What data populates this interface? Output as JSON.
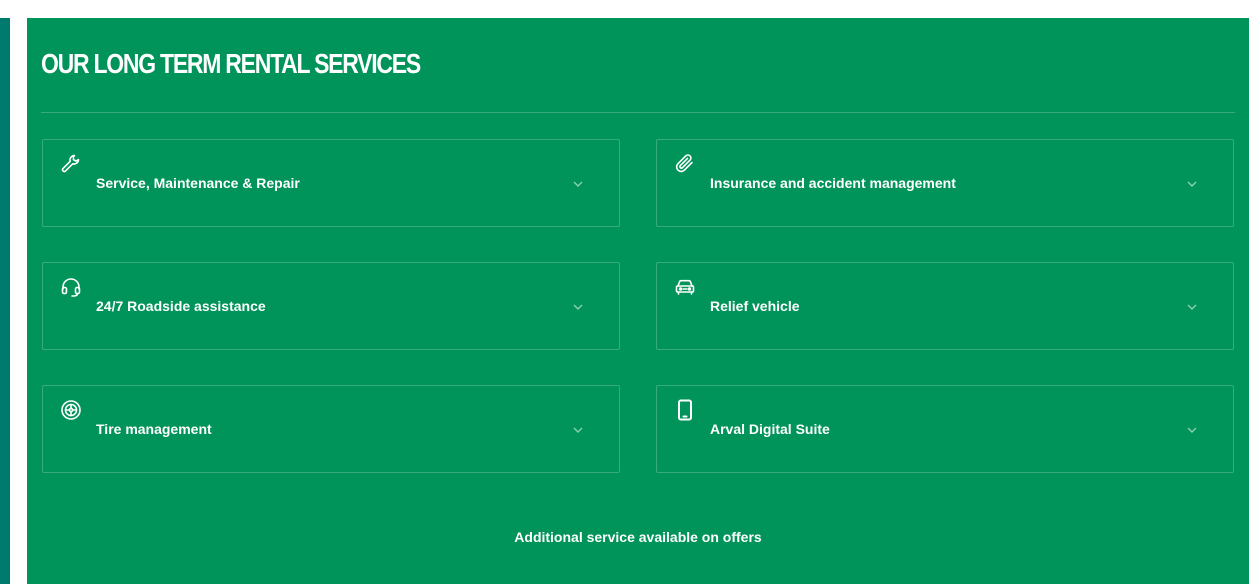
{
  "section": {
    "title": "OUR LONG TERM RENTAL SERVICES",
    "footer_note": "Additional service available on offers"
  },
  "services": [
    {
      "label": "Service, Maintenance & Repair",
      "icon": "wrench-icon"
    },
    {
      "label": "Insurance and accident management",
      "icon": "paperclip-icon"
    },
    {
      "label": "24/7 Roadside assistance",
      "icon": "headset-icon"
    },
    {
      "label": "Relief vehicle",
      "icon": "car-icon"
    },
    {
      "label": "Tire management",
      "icon": "tire-icon"
    },
    {
      "label": "Arval Digital Suite",
      "icon": "smartphone-icon"
    }
  ],
  "colors": {
    "panel_background": "#00945a",
    "outer_frame": "#007a6c",
    "text": "#ffffff"
  }
}
